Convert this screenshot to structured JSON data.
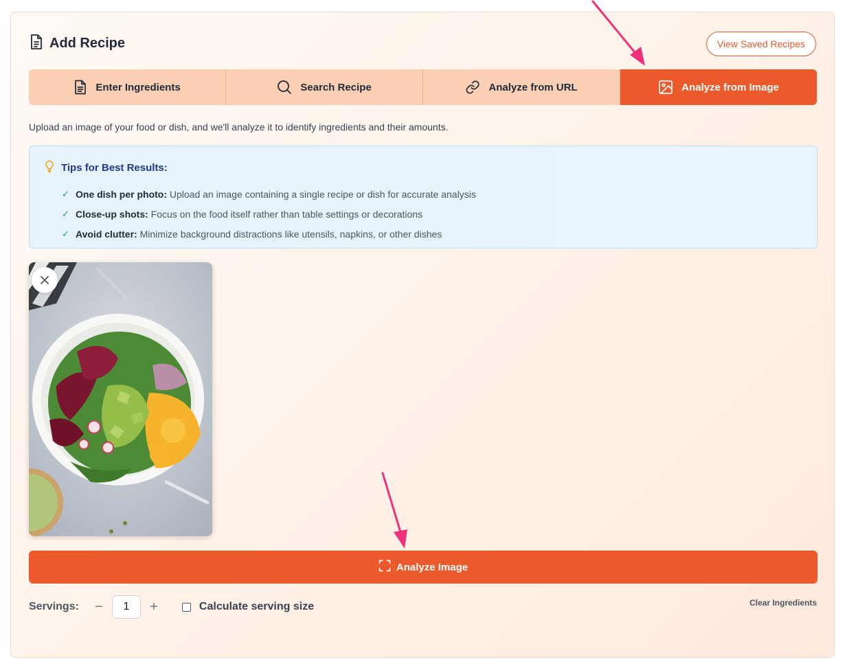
{
  "header": {
    "title": "Add Recipe",
    "saved_button": "View Saved Recipes"
  },
  "tabs": [
    {
      "label": "Enter Ingredients",
      "icon": "document-icon",
      "active": false
    },
    {
      "label": "Search Recipe",
      "icon": "search-icon",
      "active": false
    },
    {
      "label": "Analyze from URL",
      "icon": "link-icon",
      "active": false
    },
    {
      "label": "Analyze from Image",
      "icon": "image-icon",
      "active": true
    }
  ],
  "description": "Upload an image of your food or dish, and we'll analyze it to identify ingredients and their amounts.",
  "tips": {
    "title": "Tips for Best Results:",
    "items": [
      {
        "bold": "One dish per photo:",
        "text": "Upload an image containing a single recipe or dish for accurate analysis"
      },
      {
        "bold": "Close-up shots:",
        "text": "Focus on the food itself rather than table settings or decorations"
      },
      {
        "bold": "Avoid clutter:",
        "text": "Minimize background distractions like utensils, napkins, or other dishes"
      }
    ]
  },
  "analyze_button": "Analyze Image",
  "servings": {
    "label": "Servings:",
    "minus": "−",
    "value": "1",
    "plus": "+",
    "calculate_label": "Calculate serving size",
    "calculate_checked": false
  },
  "clear_link": "Clear Ingredients",
  "colors": {
    "accent": "#ec5a2b",
    "tab_inactive": "#fbcfb3",
    "tips_title": "#1e3a8a",
    "check": "#22a06b",
    "annotation_arrow": "#f0307a"
  }
}
